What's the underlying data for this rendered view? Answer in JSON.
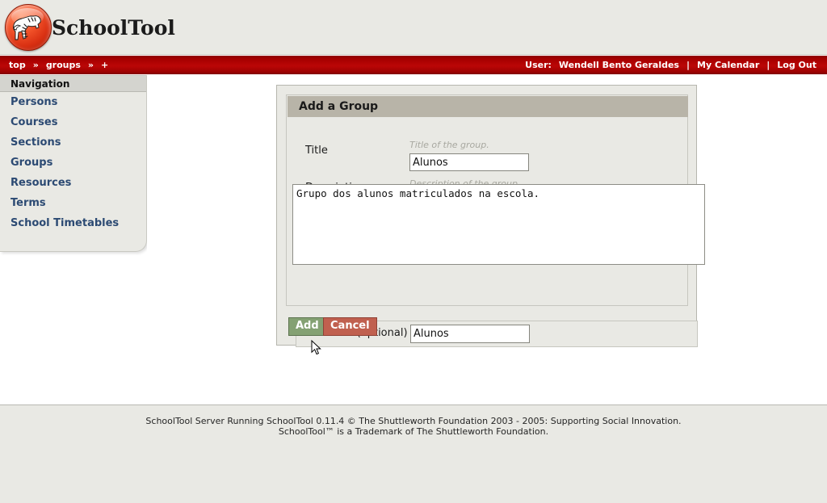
{
  "app": {
    "title": "SchoolTool",
    "logo_icon": "zebra-logo-icon"
  },
  "navbar": {
    "breadcrumb": [
      {
        "label": "top",
        "icon": ""
      },
      {
        "label": "»",
        "icon": "chevron-double-right-icon"
      },
      {
        "label": "groups",
        "icon": ""
      },
      {
        "label": "»",
        "icon": "chevron-double-right-icon"
      },
      {
        "label": "+",
        "icon": "plus-icon"
      }
    ],
    "user_label": "User:",
    "user_name": "Wendell Bento Geraldes",
    "separator": "|",
    "my_calendar": "My Calendar",
    "log_out": "Log Out"
  },
  "sidebar": {
    "header": "Navigation",
    "items": [
      {
        "label": "Persons"
      },
      {
        "label": "Courses"
      },
      {
        "label": "Sections"
      },
      {
        "label": "Groups"
      },
      {
        "label": "Resources"
      },
      {
        "label": "Terms"
      },
      {
        "label": "School Timetables"
      }
    ]
  },
  "form": {
    "title": "Add a Group",
    "title_field": {
      "label": "Title",
      "hint": "Title of the group.",
      "value": "Alunos",
      "placeholder": ""
    },
    "description_field": {
      "label": "Description",
      "hint": "Description of the group.",
      "value": "Grupo dos alunos matriculados na escola.",
      "placeholder": ""
    },
    "identifier_field": {
      "label": "Identifier (optional)",
      "value": "Alunos",
      "placeholder": ""
    },
    "buttons": {
      "add": "Add",
      "cancel": "Cancel"
    }
  },
  "footer": {
    "line1": "SchoolTool Server Running SchoolTool 0.11.4 © The Shuttleworth Foundation 2003 - 2005: Supporting Social Innovation.",
    "line2": "SchoolTool™ is a Trademark of The Shuttleworth Foundation."
  },
  "colors": {
    "brand_red": "#a60000",
    "page_bg": "#e9e9e4",
    "content_bg": "#ffffff",
    "panel_header": "#b8b4a8",
    "nav_link": "#2c4a73",
    "add_button": "#84a173",
    "cancel_button": "#c0604f",
    "hint_text": "#a8a8a0"
  }
}
